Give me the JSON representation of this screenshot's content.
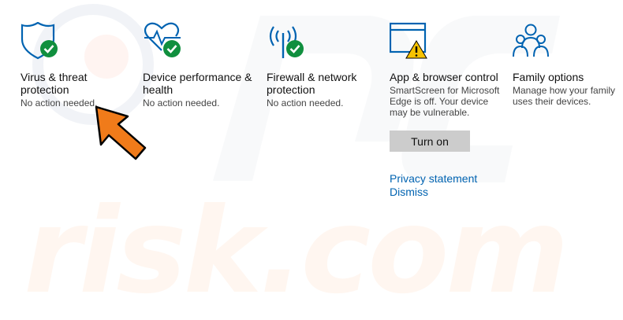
{
  "tiles": [
    {
      "icon": "shield-check-icon",
      "title": "Virus & threat protection",
      "status": "No action needed."
    },
    {
      "icon": "heart-pulse-check-icon",
      "title": "Device performance & health",
      "status": "No action needed."
    },
    {
      "icon": "antenna-check-icon",
      "title": "Firewall & network protection",
      "status": "No action needed."
    },
    {
      "icon": "browser-warning-icon",
      "title": "App & browser control",
      "status": "SmartScreen for Microsoft Edge is off.  Your device may be vulnerable."
    },
    {
      "icon": "family-icon",
      "title": "Family options",
      "status": "Manage how your family uses their devices."
    }
  ],
  "app_browser": {
    "button_label": "Turn on",
    "privacy_link": "Privacy statement",
    "dismiss_link": "Dismiss"
  },
  "watermark": "risk.com",
  "colors": {
    "accent": "#0063b1",
    "ok": "#108f3e",
    "warn": "#f6c200",
    "arrow": "#f07b1a"
  }
}
